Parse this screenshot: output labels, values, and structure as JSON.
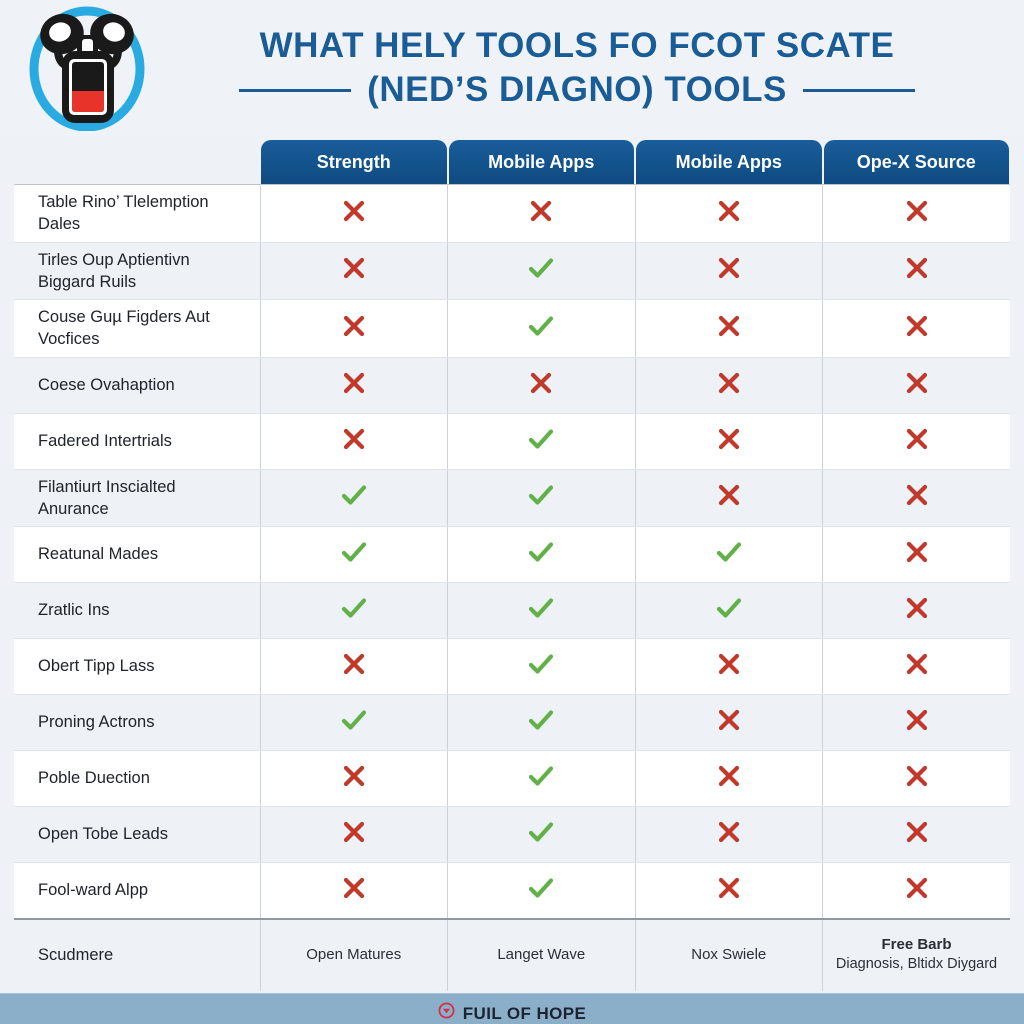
{
  "header": {
    "title_line1": "WHAT HELY TOOLS FO FCOT SCATE",
    "title_line2": "(NED’S DIAGNO) TOOLS",
    "logo_icon": "obd-scanner-icon",
    "title_color": "#1a5c96",
    "logo_ring_color": "#29abe2",
    "logo_body_color": "#1a1a1a",
    "logo_accent_color": "#e8332a"
  },
  "table": {
    "blank_header": "",
    "columns": [
      "Strength",
      "Mobile Apps",
      "Mobile Apps",
      "Ope-X Source"
    ],
    "header_bg": "#13538c",
    "check_color": "#62b148",
    "cross_color": "#c0392b",
    "rows": [
      {
        "label": "Table Rino’ Tlelemption Dales",
        "marks": [
          "cross",
          "cross",
          "cross",
          "cross"
        ]
      },
      {
        "label": "Tirles Oup Aptientivn Biggard Ruils",
        "marks": [
          "cross",
          "check",
          "cross",
          "cross"
        ]
      },
      {
        "label": "Couse Guµ Figders Aut Vocfices",
        "marks": [
          "cross",
          "check",
          "cross",
          "cross"
        ]
      },
      {
        "label": "Coese Ovahaption",
        "marks": [
          "cross",
          "cross",
          "cross",
          "cross"
        ]
      },
      {
        "label": "Fadered Intertrials",
        "marks": [
          "cross",
          "check",
          "cross",
          "cross"
        ]
      },
      {
        "label": "Filantiurt Inscialted Anurance",
        "marks": [
          "check",
          "check",
          "cross",
          "cross"
        ]
      },
      {
        "label": "Reatunal Mades",
        "marks": [
          "check",
          "check",
          "check",
          "cross"
        ]
      },
      {
        "label": "Zratlic Ins",
        "marks": [
          "check",
          "check",
          "check",
          "cross"
        ]
      },
      {
        "label": "Obert Tipp Lass",
        "marks": [
          "cross",
          "check",
          "cross",
          "cross"
        ]
      },
      {
        "label": "Proning Actrons",
        "marks": [
          "check",
          "check",
          "cross",
          "cross"
        ]
      },
      {
        "label": "Poble Duection",
        "marks": [
          "cross",
          "check",
          "cross",
          "cross"
        ]
      },
      {
        "label": "Open Tobe Leads",
        "marks": [
          "cross",
          "check",
          "cross",
          "cross"
        ]
      },
      {
        "label": "Fool-ward Alpp",
        "marks": [
          "cross",
          "check",
          "cross",
          "cross"
        ]
      }
    ],
    "summary": {
      "label": "Scudmere",
      "cells": [
        {
          "main": "Open Matures",
          "sub": ""
        },
        {
          "main": "Langet Wave",
          "sub": ""
        },
        {
          "main": "Nox Swiele",
          "sub": ""
        },
        {
          "main": "Free Barb",
          "sub": "Diagnosis, Bltidx Diygard"
        }
      ]
    }
  },
  "bottom_banner": {
    "text": "FUIL OF HOPE",
    "icon": "red-circle-check-icon",
    "bg_color": "#8cafc9",
    "icon_color": "#d0324a"
  }
}
